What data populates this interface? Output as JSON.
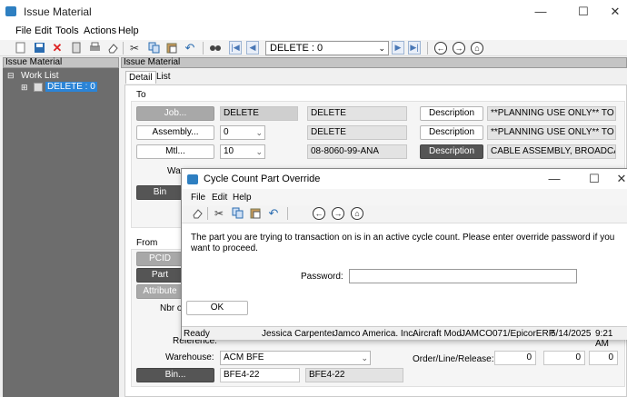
{
  "window": {
    "title": "Issue Material",
    "minimize": "—",
    "maximize": "☐",
    "close": "✕"
  },
  "menu": [
    "File",
    "Edit",
    "Tools",
    "Actions",
    "Help"
  ],
  "toolbar": {
    "nav_combo": "DELETE : 0"
  },
  "tree": {
    "header": "Issue Material",
    "root": "Work List",
    "item": "DELETE : 0",
    "expand": "⊞"
  },
  "main": {
    "header": "Issue Material",
    "tabs": [
      "Detail",
      "List"
    ],
    "to_group": {
      "label": "To",
      "job_button": "Job...",
      "job_value": "DELETE",
      "job_desc": "DELETE",
      "assembly_button": "Assembly...",
      "assembly_value": "0",
      "assembly_desc": "DELETE",
      "mtl_button": "Mtl...",
      "mtl_value": "10",
      "mtl_part": "08-8060-99-ANA",
      "description_button": "Description",
      "desc1": "**PLANNING USE ONLY** TO DE",
      "desc2": "**PLANNING USE ONLY** TO DE",
      "desc3": "CABLE ASSEMBLY, BROADCAS",
      "warehouse_label": "Wa",
      "bin_label": "Bin"
    },
    "from_group": {
      "label": "From",
      "pc_label": "PCID",
      "part_label": "Part",
      "attr_label": "Attribute",
      "nbr_label": "Nbr o",
      "reference_label": "Reference:",
      "warehouse_label": "Warehouse:",
      "warehouse_value": "ACM BFE",
      "bin_button": "Bin...",
      "bin_value": "BFE4-22",
      "bin_desc": "BFE4-22",
      "order_label": "Order/Line/Release:",
      "order": "0",
      "line": "0",
      "release": "0"
    }
  },
  "dialog": {
    "title": "Cycle Count Part Override",
    "menu": [
      "File",
      "Edit",
      "Help"
    ],
    "message": "The part you are trying to transaction on is in an active cycle count. Please enter override password if you want to proceed.",
    "password_label": "Password:",
    "password_value": "",
    "ok_label": "OK",
    "status": {
      "state": "Ready",
      "user": "Jessica Carpenter",
      "company": "Jamco America. Inc.",
      "site": "Aircraft Mod",
      "server": "JAMCO071/EpicorERP",
      "date": "5/14/2025",
      "time": "9:21 AM"
    }
  }
}
